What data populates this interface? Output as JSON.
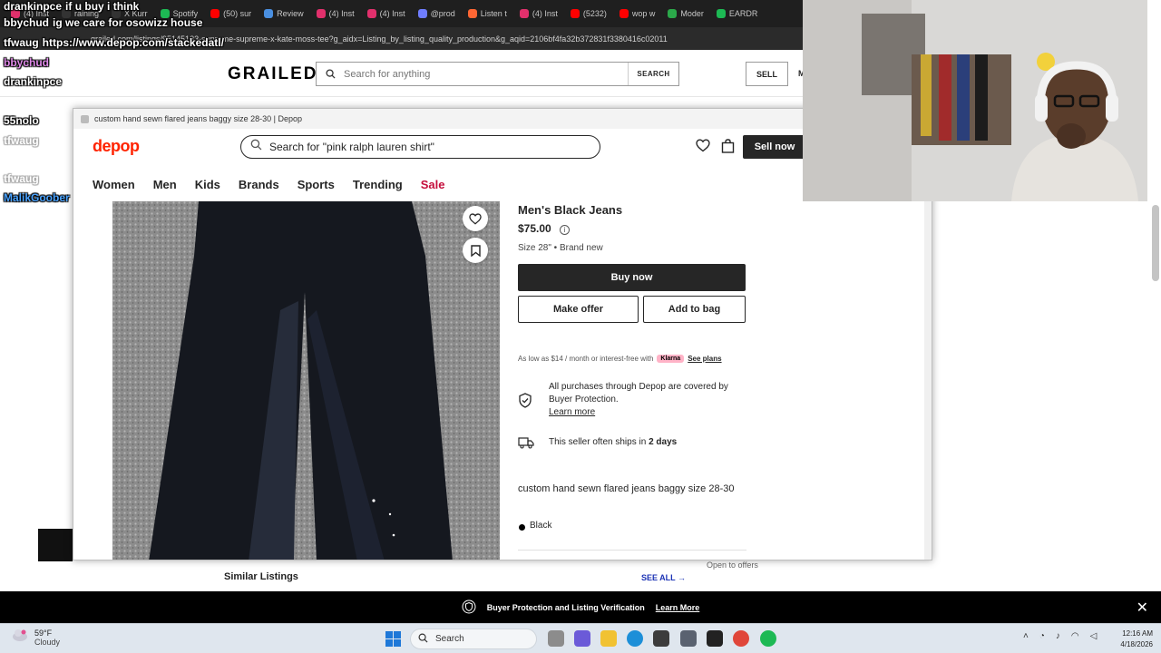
{
  "chat": {
    "messages": [
      {
        "name": "drankinpce",
        "text": "if u buy i think",
        "name_color": "#ffffff"
      },
      {
        "name": "bbychud",
        "text": "ig we care for osowizz house",
        "name_color": "#ffffff"
      },
      {
        "name": "tfwaug",
        "text": "https://www.depop.com/stackedatl/",
        "name_color": "#ffffff"
      },
      {
        "name": "bbychud",
        "text": "",
        "name_color": "#e08ae9"
      },
      {
        "name": "drankinpce",
        "text": "",
        "name_color": "#ffffff"
      },
      {
        "name": "55nolo",
        "text": "",
        "name_color": "#ffffff"
      },
      {
        "name": "tfwaug",
        "text": "",
        "name_color": "#ffffff"
      },
      {
        "name": "tfwaug",
        "text": "",
        "name_color": "#ffffff"
      },
      {
        "name": "MalikGoober",
        "text": "",
        "name_color": "#4aa3ff"
      }
    ]
  },
  "bg_browser": {
    "tabs": [
      "(4) Inst",
      "raining",
      "X Kurr",
      "Spotify",
      "(50) sur",
      "Review",
      "(4) Inst",
      "(4) Inst",
      "@prod",
      "Listen t",
      "(4) Inst",
      "(5232)",
      "wop w",
      "Moder",
      "EARDR"
    ],
    "url": "grailed.com/listings/95145133-supreme-supreme-x-kate-moss-tee?g_aidx=Listing_by_listing_quality_production&g_aqid=2106bf4fa32b372831f3380416c02011",
    "logo": "GRAILED",
    "search_placeholder": "Search for anything",
    "search_button": "SEARCH",
    "sell_button": "SELL",
    "nav_cut": "M",
    "similar_listings": "Similar Listings",
    "see_all": "SEE ALL →",
    "open_to_offers": "Open to offers",
    "banner_text": "Buyer Protection and Listing Verification",
    "banner_link": "Learn More",
    "banner_close": "✕"
  },
  "depop": {
    "window_title": "custom hand sewn flared jeans baggy size 28-30 | Depop",
    "logo": "depop",
    "search_text": "Search for \"pink ralph lauren shirt\"",
    "sell_button": "Sell now",
    "nav": [
      "Women",
      "Men",
      "Kids",
      "Brands",
      "Sports",
      "Trending",
      "Sale"
    ],
    "product": {
      "title": "Men's Black Jeans",
      "price": "$75.00",
      "size": "Size 28\" • Brand new",
      "buy_now": "Buy now",
      "make_offer": "Make offer",
      "add_to_bag": "Add to bag",
      "klarna_text": "As low as $14 / month or interest-free with",
      "klarna_badge": "Klarna",
      "see_plans": "See plans",
      "protection_text": "All purchases through Depop are covered by Buyer Protection.",
      "learn_more": "Learn more",
      "ships_text": "This seller often ships in",
      "ships_days": "2 days",
      "description": "custom hand sewn flared jeans baggy size 28-30",
      "color": "Black"
    }
  },
  "taskbar": {
    "weather_temp": "59°F",
    "weather_desc": "Cloudy",
    "search_label": "Search",
    "time": "12:16 AM",
    "date": "4/18/2026"
  },
  "colors": {
    "depop_red": "#ff2300",
    "sale_red": "#c50e3c",
    "klarna_pink": "#ffb3c7",
    "dark": "#262626"
  }
}
